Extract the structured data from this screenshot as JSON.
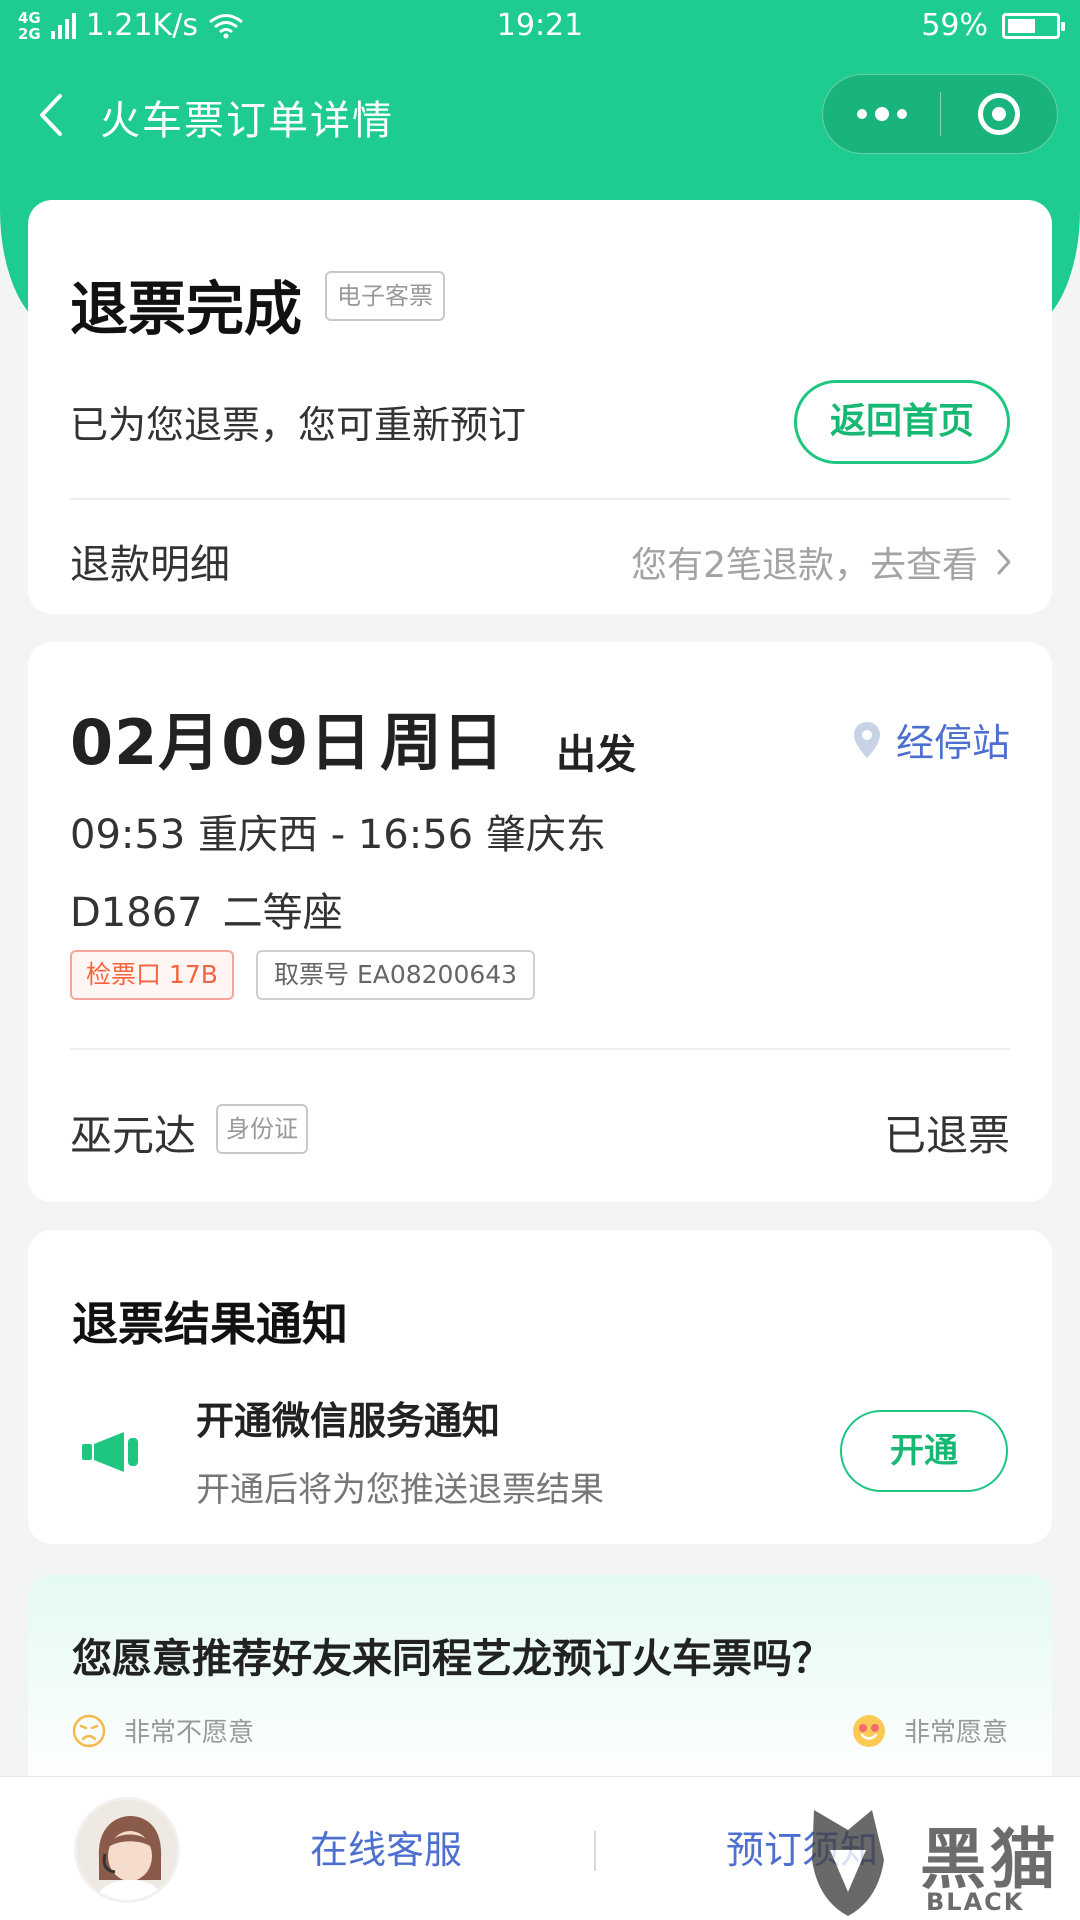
{
  "colors": {
    "brand": "#1dcc8e",
    "accent_text": "#17b873",
    "link": "#4c6fd0",
    "warn": "#f5643f"
  },
  "status_bar": {
    "network": "4G 2G",
    "speed": "1.21K/s",
    "time": "19:21",
    "battery": "59%",
    "battery_level": 0.59
  },
  "nav": {
    "title": "火车票订单详情",
    "back_icon": "chevron-left-icon",
    "more_icon": "more-dots-icon",
    "close_icon": "target-close-icon"
  },
  "refund_status": {
    "title": "退票完成",
    "ticket_type": "电子客票",
    "description": "已为您退票，您可重新预订",
    "home_button": "返回首页",
    "detail_label": "退款明细",
    "detail_link": "您有2笔退款，去查看"
  },
  "trip": {
    "date": "02月09日",
    "weekday": "周日",
    "depart_label": "出发",
    "stops_link": "经停站",
    "route": "09:53 重庆西 - 16:56 肇庆东",
    "train_no": "D1867",
    "seat": "二等座",
    "gate": "检票口 17B",
    "ticket_no": "取票号 EA08200643",
    "passenger_name": "巫元达",
    "id_type": "身份证",
    "ticket_status": "已退票"
  },
  "notification": {
    "title": "退票结果通知",
    "service_title": "开通微信服务通知",
    "service_desc": "开通后将为您推送退票结果",
    "open_button": "开通"
  },
  "survey": {
    "question": "您愿意推荐好友来同程艺龙预订火车票吗？",
    "low_label": "非常不愿意",
    "high_label": "非常愿意"
  },
  "bottom_bar": {
    "customer_service": "在线客服",
    "booking_notice": "预订须知"
  },
  "watermark": {
    "text": "黑猫",
    "sub": "BLACK CAT"
  }
}
